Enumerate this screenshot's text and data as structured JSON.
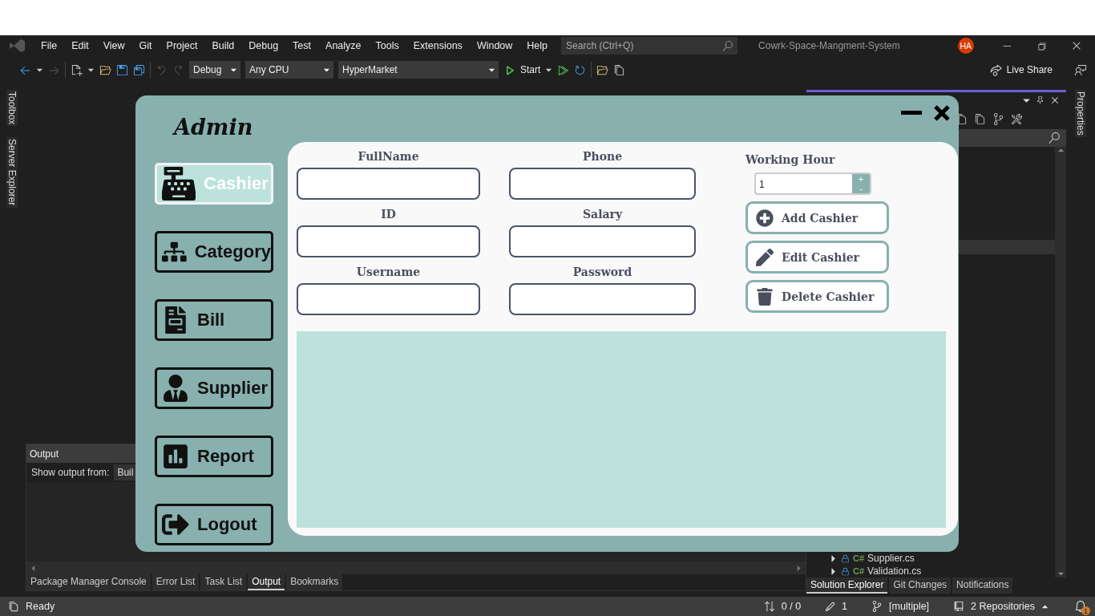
{
  "ide": {
    "menu": [
      "File",
      "Edit",
      "View",
      "Git",
      "Project",
      "Build",
      "Debug",
      "Test",
      "Analyze",
      "Tools",
      "Extensions",
      "Window",
      "Help"
    ],
    "search": {
      "placeholder": "Search (Ctrl+Q)"
    },
    "title": "Cowrk-Space-Mangment-System",
    "avatar": "HA",
    "toolbar": {
      "configuration": "Debug",
      "platform": "Any CPU",
      "project": "HyperMarket",
      "start": "Start",
      "live_share": "Live Share"
    },
    "left_rail": [
      "Toolbox",
      "Server Explorer"
    ],
    "right_rail": [
      "Properties"
    ],
    "output": {
      "title": "Output",
      "show_from_label": "Show output from:",
      "source": "Buil"
    },
    "bottom_tabs": [
      {
        "label": "Package Manager Console",
        "selected": false
      },
      {
        "label": "Error List",
        "selected": false
      },
      {
        "label": "Task List",
        "selected": false
      },
      {
        "label": "Output",
        "selected": true
      },
      {
        "label": "Bookmarks",
        "selected": false
      }
    ],
    "solution_explorer": {
      "items": [
        {
          "lang": "C#",
          "name": "Supplier.cs"
        },
        {
          "lang": "C#",
          "name": "Validation.cs"
        }
      ],
      "tabs": [
        {
          "label": "Solution Explorer",
          "selected": true
        },
        {
          "label": "Git Changes",
          "selected": false
        },
        {
          "label": "Notifications",
          "selected": false
        }
      ]
    },
    "status_bar": {
      "state": "Ready",
      "sync": "0 / 0",
      "edits": "1",
      "branch": "[multiple]",
      "repositories": "2 Repositories",
      "notifications": "1"
    }
  },
  "app": {
    "title": "Admin",
    "nav": [
      {
        "label": "Cashier",
        "selected": true
      },
      {
        "label": "Category",
        "selected": false
      },
      {
        "label": "Bill",
        "selected": false
      },
      {
        "label": "Supplier",
        "selected": false
      },
      {
        "label": "Report",
        "selected": false
      },
      {
        "label": "Logout",
        "selected": false
      }
    ],
    "fields": [
      {
        "label": "FullName"
      },
      {
        "label": "Phone"
      },
      {
        "label": "ID"
      },
      {
        "label": "Salary"
      },
      {
        "label": "Username"
      },
      {
        "label": "Password"
      }
    ],
    "working_hour": {
      "label": "Working Hour",
      "value": "1",
      "up": "+",
      "down": "-"
    },
    "actions": [
      {
        "label": "Add Cashier"
      },
      {
        "label": "Edit Cashier"
      },
      {
        "label": "Delete Cashier"
      }
    ]
  }
}
